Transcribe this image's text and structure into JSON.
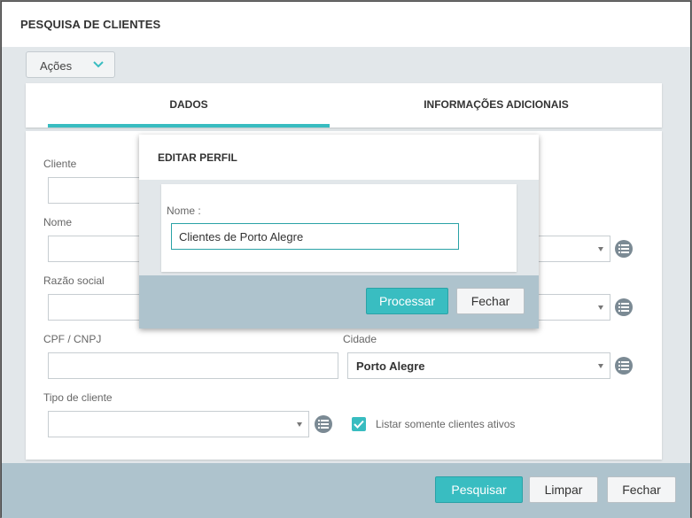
{
  "window": {
    "title": "PESQUISA DE CLIENTES"
  },
  "actions": {
    "label": "Ações"
  },
  "tabs": [
    {
      "label": "DADOS",
      "active": true
    },
    {
      "label": "INFORMAÇÕES ADICIONAIS",
      "active": false
    }
  ],
  "form": {
    "cliente_label": "Cliente",
    "nome_label": "Nome",
    "razao_label": "Razão social",
    "cpf_label": "CPF / CNPJ",
    "cidade_label": "Cidade",
    "cidade_value": "Porto Alegre",
    "tipo_label": "Tipo de cliente",
    "ativos_label": "Listar somente clientes ativos",
    "ativos_checked": true
  },
  "footer": {
    "pesquisar": "Pesquisar",
    "limpar": "Limpar",
    "fechar": "Fechar"
  },
  "modal": {
    "title": "EDITAR PERFIL",
    "nome_label": "Nome :",
    "nome_value": "Clientes de Porto Alegre",
    "processar": "Processar",
    "fechar": "Fechar"
  },
  "colors": {
    "accent": "#39bdc1",
    "footer_bg": "#aec3cd",
    "content_bg": "#e2e7ea",
    "icon_gray": "#7b8a94"
  },
  "icons": [
    "chevron-down-icon",
    "list-icon",
    "checkmark-icon"
  ]
}
